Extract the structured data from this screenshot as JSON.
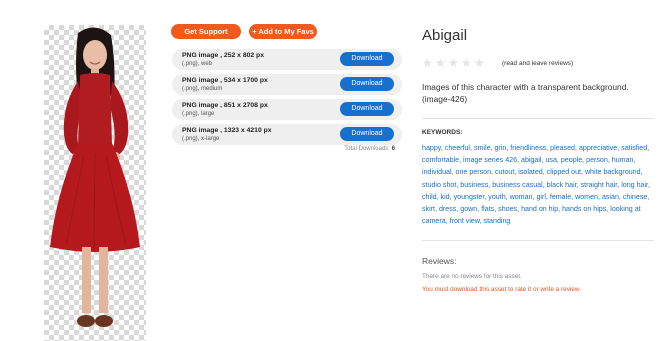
{
  "actions": {
    "get_support": "Get Support",
    "add_favs": "+ Add to My Favs"
  },
  "downloads": [
    {
      "title": "PNG image , 252 x 802 px",
      "sub": "(.png), web",
      "button": "Download"
    },
    {
      "title": "PNG image , 534 x 1700 px",
      "sub": "(.png), medium",
      "button": "Download"
    },
    {
      "title": "PNG image , 851 x 2708 px",
      "sub": "(.png), large",
      "button": "Download"
    },
    {
      "title": "PNG image , 1323 x 4210 px",
      "sub": "(.png), x-large",
      "button": "Download"
    }
  ],
  "total_downloads": {
    "label": "Total Downloads:",
    "value": "6"
  },
  "asset": {
    "title": "Abigail",
    "rating": {
      "stars": 0,
      "max": 5,
      "link": "(read and leave reviews)"
    },
    "description": "Images of this character with a transparent background. (image-426)"
  },
  "keywords": {
    "label": "KEYWORDS:",
    "items": [
      "happy",
      "cheerful",
      "smile",
      "grin",
      "friendliness",
      "pleased",
      "appreciative",
      "satisfied",
      "comfortable",
      "image series 426",
      "abigail",
      "usa",
      "people",
      "person",
      "human",
      "individual",
      "one person",
      "cutout",
      "isolated",
      "clipped out",
      "white background",
      "studio shot",
      "business",
      "business casual",
      "black hair",
      "straight hair",
      "long hair",
      "child",
      "kid",
      "youngster",
      "youth",
      "woman",
      "girl",
      "female",
      "women",
      "asian",
      "chinese",
      "skirt",
      "dress",
      "gown",
      "flats",
      "shoes",
      "hand on hip",
      "hands on hips",
      "looking at camera",
      "front view",
      "standing"
    ]
  },
  "reviews": {
    "title": "Reviews:",
    "none": "There are no reviews for this asset.",
    "warning": "You must download this asset to rate it or write a review."
  },
  "colors": {
    "accent": "#f15a1e",
    "link": "#1a6fc4",
    "download_btn": "#1670cc"
  }
}
